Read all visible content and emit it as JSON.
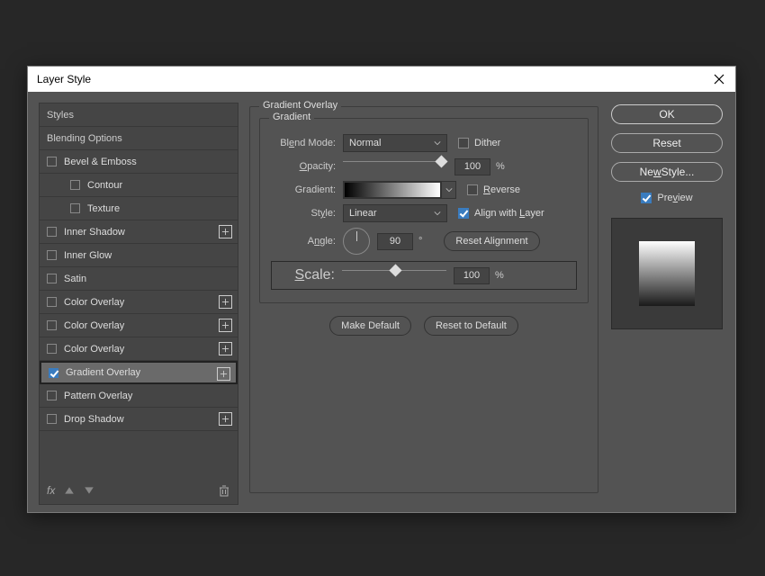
{
  "dialog": {
    "title": "Layer Style"
  },
  "styles": {
    "header": "Styles",
    "blending": "Blending Options",
    "items": [
      {
        "label": "Bevel & Emboss",
        "checked": false,
        "plus": false
      },
      {
        "label": "Contour",
        "indent": true
      },
      {
        "label": "Texture",
        "indent": true
      },
      {
        "label": "Inner Shadow",
        "checked": false,
        "plus": true
      },
      {
        "label": "Inner Glow",
        "checked": false
      },
      {
        "label": "Satin",
        "checked": false
      },
      {
        "label": "Color Overlay",
        "checked": false,
        "plus": true
      },
      {
        "label": "Color Overlay",
        "checked": false,
        "plus": true
      },
      {
        "label": "Color Overlay",
        "checked": false,
        "plus": true
      },
      {
        "label": "Gradient Overlay",
        "checked": true,
        "plus": true,
        "selected": true
      },
      {
        "label": "Pattern Overlay",
        "checked": false
      },
      {
        "label": "Drop Shadow",
        "checked": false,
        "plus": true
      }
    ],
    "footer_fx": "fx"
  },
  "gradient": {
    "panel_title": "Gradient Overlay",
    "group_title": "Gradient",
    "blend_mode_label": "Blend Mode:",
    "blend_mode_value": "Normal",
    "dither_label": "Dither",
    "dither_checked": false,
    "opacity_label": "Opacity:",
    "opacity_value": "100",
    "opacity_unit": "%",
    "gradient_label": "Gradient:",
    "reverse_label": "Reverse",
    "reverse_checked": false,
    "style_label": "Style:",
    "style_value": "Linear",
    "align_label": "Align with Layer",
    "align_checked": true,
    "angle_label": "Angle:",
    "angle_value": "90",
    "angle_unit": "°",
    "reset_align": "Reset Alignment",
    "scale_label": "Scale:",
    "scale_value": "100",
    "scale_unit": "%",
    "make_default": "Make Default",
    "reset_default": "Reset to Default"
  },
  "right": {
    "ok": "OK",
    "reset": "Reset",
    "new_style": "New Style...",
    "preview_label": "Preview",
    "preview_checked": true
  }
}
